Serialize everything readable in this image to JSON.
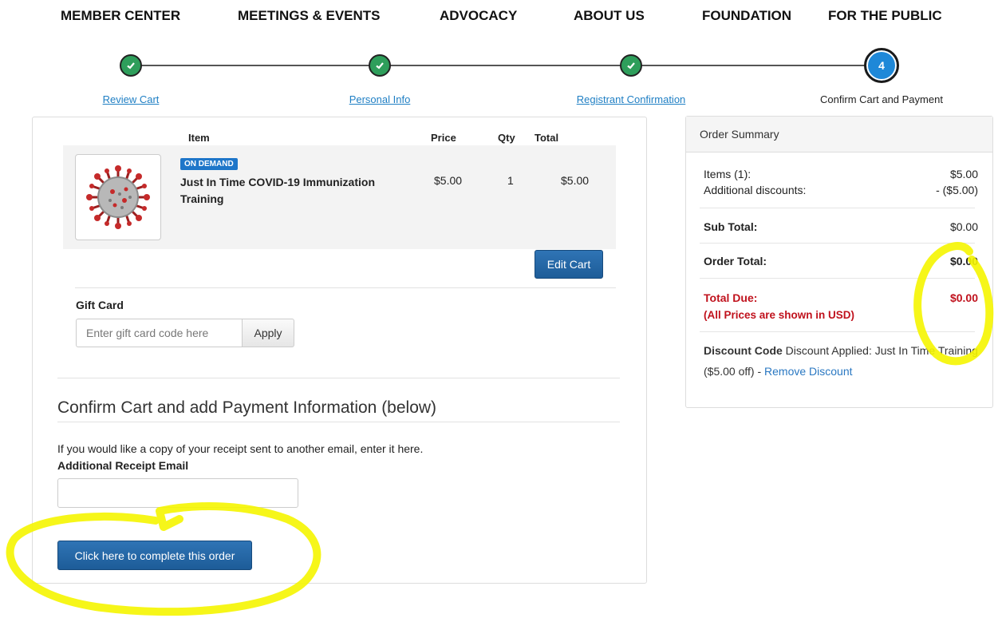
{
  "nav": {
    "items": [
      "MEMBER CENTER",
      "MEETINGS & EVENTS",
      "ADVOCACY",
      "ABOUT US",
      "FOUNDATION",
      "FOR THE PUBLIC"
    ]
  },
  "stepper": {
    "steps": [
      {
        "label": "Review Cart",
        "state": "done"
      },
      {
        "label": "Personal Info",
        "state": "done"
      },
      {
        "label": "Registrant Confirmation",
        "state": "done"
      },
      {
        "label": "Confirm Cart and Payment",
        "state": "current",
        "number": "4"
      }
    ]
  },
  "cart": {
    "headers": {
      "item": "Item",
      "price": "Price",
      "qty": "Qty",
      "total": "Total"
    },
    "items": [
      {
        "badge": "ON DEMAND",
        "title": "Just In Time COVID-19 Immunization Training",
        "price": "$5.00",
        "qty": "1",
        "total": "$5.00",
        "image": "coronavirus-image"
      }
    ],
    "edit_label": "Edit Cart"
  },
  "gift": {
    "label": "Gift Card",
    "placeholder": "Enter gift card code here",
    "apply_label": "Apply"
  },
  "payment": {
    "title": "Confirm Cart and add Payment Information (below)",
    "help": "If you would like a copy of your receipt sent to another email, enter it here.",
    "receipt_label": "Additional Receipt Email",
    "receipt_value": "",
    "complete_label": "Click here to complete this order"
  },
  "summary": {
    "title": "Order Summary",
    "items_label": "Items (1):",
    "items_value": "$5.00",
    "discounts_label": "Additional discounts:",
    "discounts_value": "- ($5.00)",
    "subtotal_label": "Sub Total:",
    "subtotal_value": "$0.00",
    "order_total_label": "Order Total:",
    "order_total_value": "$0.00",
    "due_label": "Total Due:",
    "due_value": "$0.00",
    "usd_note": "(All Prices are shown in USD)",
    "discount_code_label": "Discount Code",
    "discount_text": "Discount Applied: Just In Time Training ($5.00 off) -",
    "remove_label": "Remove Discount"
  },
  "colors": {
    "accent_blue": "#1f5f9e",
    "step_green": "#2e9e5b",
    "step_active": "#1e88d8",
    "alert_red": "#c0121d",
    "highlight_yellow": "#f5f500"
  }
}
